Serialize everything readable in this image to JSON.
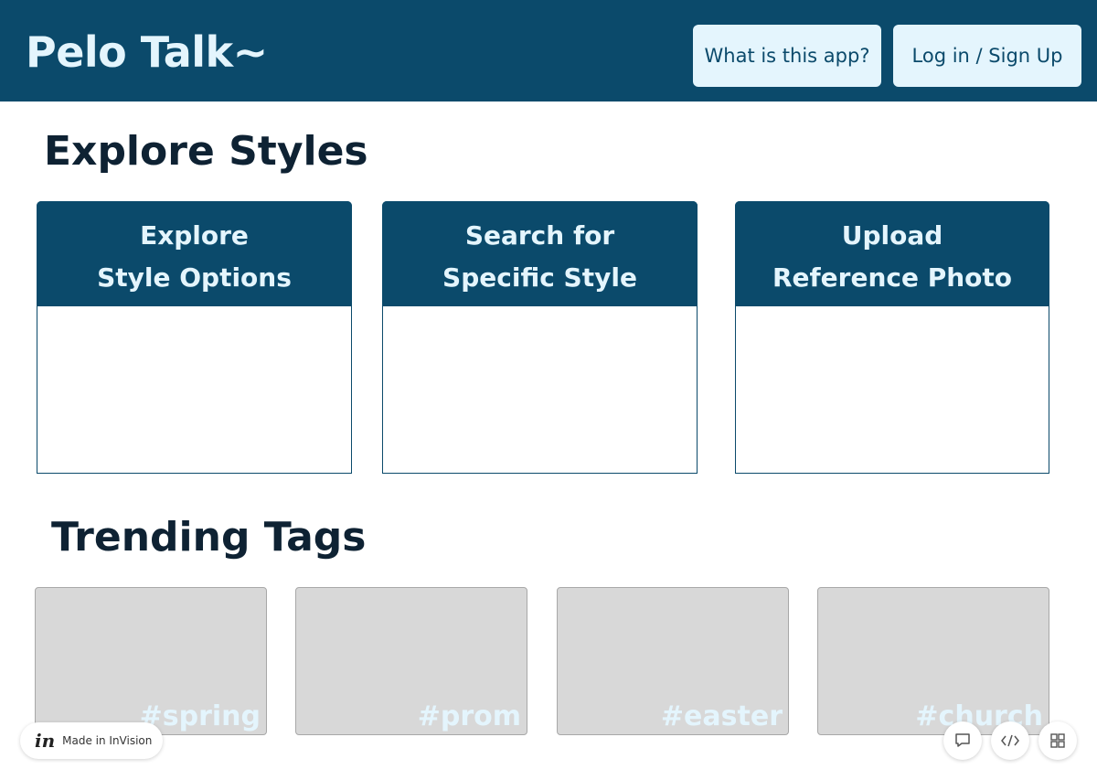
{
  "header": {
    "title": "Pelo Talk~",
    "what_label": "What is this app?",
    "login_label": "Log in / Sign Up",
    "colors": {
      "primary": "#0b4a6b",
      "light": "#e4f5fd"
    }
  },
  "explore": {
    "heading": "Explore Styles",
    "cards": [
      {
        "line1": "Explore",
        "line2": "Style Options"
      },
      {
        "line1": "Search for",
        "line2": "Specific Style"
      },
      {
        "line1": "Upload",
        "line2": "Reference Photo"
      }
    ]
  },
  "trending": {
    "heading": "Trending Tags",
    "tags": [
      "#spring",
      "#prom",
      "#easter",
      "#church"
    ]
  },
  "footer": {
    "badge_text": "Made in InVision",
    "badge_logo": "in",
    "tools": [
      "comment-icon",
      "code-icon",
      "grid-icon"
    ]
  }
}
